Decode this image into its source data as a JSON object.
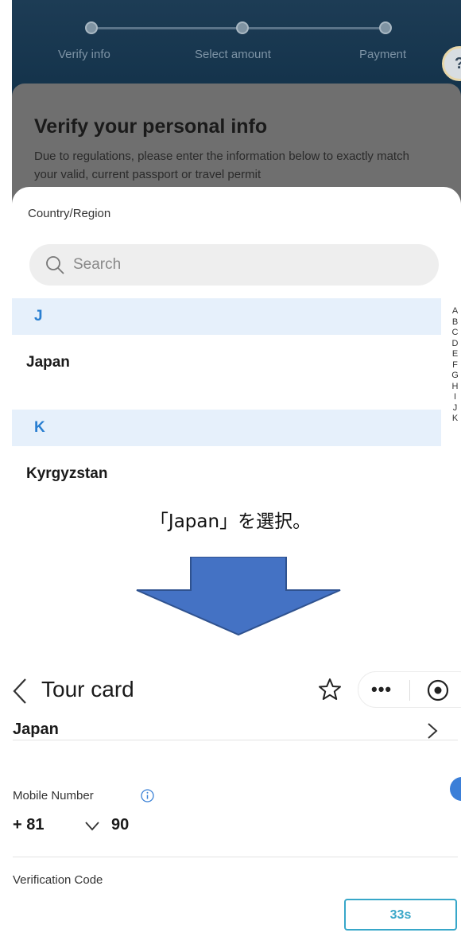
{
  "top_screen": {
    "steps": [
      "Verify info",
      "Select amount",
      "Payment"
    ],
    "help_icon": "help-icon",
    "card": {
      "title": "Verify your personal info",
      "description": "Due to regulations, please enter the information below to exactly match your valid, current passport or travel permit"
    },
    "sheet": {
      "title": "Country/Region",
      "search_placeholder": "Search",
      "groups": [
        {
          "letter": "J",
          "items": [
            "Japan"
          ]
        },
        {
          "letter": "K",
          "items": [
            "Kyrgyzstan"
          ]
        }
      ],
      "index_letters": [
        "A",
        "B",
        "C",
        "D",
        "E",
        "F",
        "G",
        "H",
        "I",
        "J",
        "K"
      ]
    }
  },
  "caption": "「Japan」を選択。",
  "arrow": {
    "color": "#4472c4",
    "direction": "down"
  },
  "bottom_screen": {
    "nav": {
      "back_icon": "chevron-left-icon",
      "title": "Tour card",
      "star_icon": "star-icon",
      "more_icon": "more-icon",
      "target_icon": "target-icon"
    },
    "country": "Japan",
    "mobile": {
      "label": "Mobile Number",
      "country_code": "+ 81",
      "number": "90"
    },
    "verification": {
      "label": "Verification Code",
      "timer": "33s"
    }
  },
  "colors": {
    "accent_blue": "#2a7fd1",
    "timer_blue": "#37a7c9",
    "header_navy": "#1d3c55"
  }
}
